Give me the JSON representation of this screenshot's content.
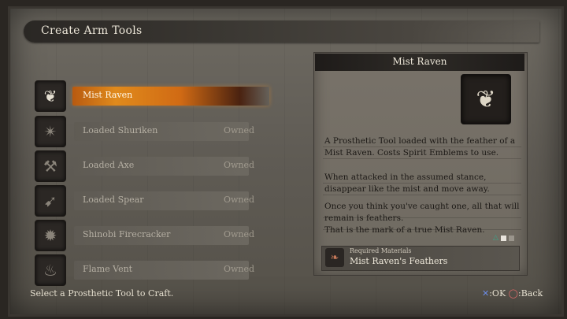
{
  "header": {
    "title": "Create Arm Tools"
  },
  "items": [
    {
      "label": "Mist Raven",
      "status": "",
      "icon": "mist-raven-icon",
      "glyph": "❦",
      "active": true
    },
    {
      "label": "Loaded Shuriken",
      "status": "Owned",
      "icon": "shuriken-icon",
      "glyph": "✴",
      "active": false
    },
    {
      "label": "Loaded Axe",
      "status": "Owned",
      "icon": "axe-icon",
      "glyph": "⚒",
      "active": false
    },
    {
      "label": "Loaded Spear",
      "status": "Owned",
      "icon": "spear-icon",
      "glyph": "➹",
      "active": false
    },
    {
      "label": "Shinobi Firecracker",
      "status": "Owned",
      "icon": "firecracker-icon",
      "glyph": "✹",
      "active": false
    },
    {
      "label": "Flame Vent",
      "status": "Owned",
      "icon": "flame-vent-icon",
      "glyph": "♨",
      "active": false
    }
  ],
  "detail": {
    "title": "Mist Raven",
    "icon": "mist-raven-large-icon",
    "paragraphs": [
      "A Prosthetic Tool loaded with the feather of a Mist Raven.  Costs Spirit Emblems to use.",
      "When attacked in the assumed stance, disappear like the mist and move away.",
      "Once you think you've caught one, all that will remain is feathers.\nThat is the mark of a true Mist Raven."
    ],
    "required_label": "Required Materials",
    "material": "Mist Raven's Feathers"
  },
  "footer": {
    "hint": "Select a Prosthetic Tool to Craft.",
    "ok_label": ":OK",
    "back_label": ":Back"
  },
  "colors": {
    "accent": "#e08a1c",
    "panel": "#7a746b",
    "cross_button": "#6c8ce6",
    "circle_button": "#e06a6a"
  }
}
